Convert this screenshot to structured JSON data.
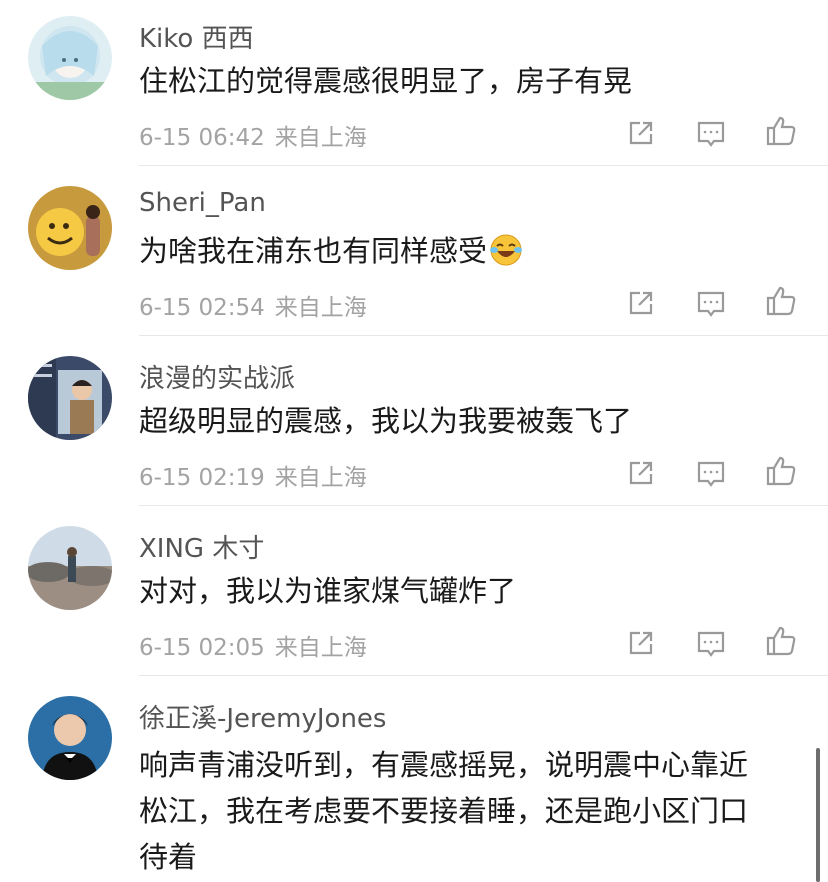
{
  "comments": [
    {
      "username": "Kiko 西西",
      "text": "住松江的觉得震感很明显了，房子有晃",
      "date": "6-15 06:42",
      "location": "来自上海"
    },
    {
      "username": "Sheri_Pan",
      "text": "为啥我在浦东也有同样感受",
      "emoji": "laughing-tears-emoji",
      "date": "6-15 02:54",
      "location": "来自上海"
    },
    {
      "username": "浪漫的实战派",
      "text": "超级明显的震感，我以为我要被轰飞了",
      "date": "6-15 02:19",
      "location": "来自上海"
    },
    {
      "username": "XING 木寸",
      "text": "对对，我以为谁家煤气罐炸了",
      "date": "6-15 02:05",
      "location": "来自上海"
    },
    {
      "username": "徐正溪-JeremyJones",
      "text_lines": [
        "响声青浦没听到，有震感摇晃，说明震中心靠近",
        "松江，我在考虑要不要接着睡，还是跑小区门口",
        "待着"
      ]
    }
  ],
  "icons": {
    "share": "share-icon",
    "reply": "comment-icon",
    "like": "thumbs-up-icon"
  }
}
